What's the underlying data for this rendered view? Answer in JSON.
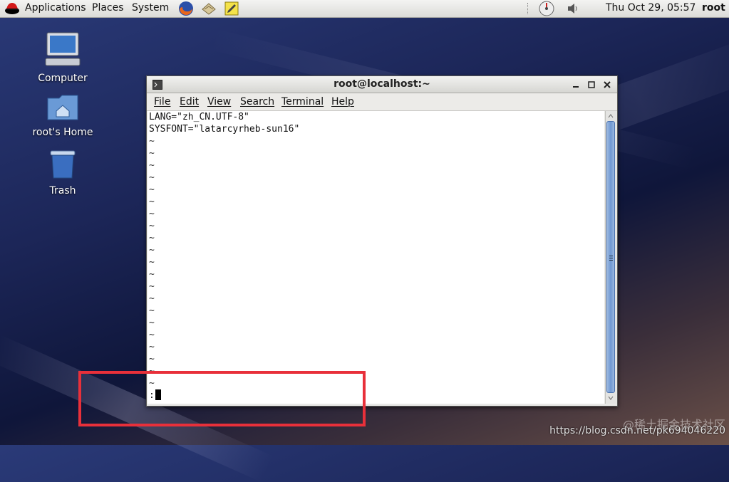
{
  "top_panel": {
    "applications": "Applications",
    "places": "Places",
    "system": "System",
    "clock": "Thu Oct 29, 05:57",
    "user": "root",
    "launchers": [
      "firefox-icon",
      "mail-icon",
      "notes-icon"
    ]
  },
  "desktop": {
    "icons": [
      {
        "label": "Computer",
        "icon": "computer-icon"
      },
      {
        "label": "root's Home",
        "icon": "home-folder-icon"
      },
      {
        "label": "Trash",
        "icon": "trash-icon"
      }
    ]
  },
  "window": {
    "title": "root@localhost:~",
    "menu": [
      "File",
      "Edit",
      "View",
      "Search",
      "Terminal",
      "Help"
    ],
    "lines": {
      "line1": "LANG=\"zh_CN.UTF-8\"",
      "line2": "SYSFONT=\"latarcyrheb-sun16\"",
      "tilde": "~",
      "prompt": ":"
    }
  },
  "annotation": {
    "box_color": "#e8303a"
  },
  "watermark": {
    "url": "https://blog.csdn.net/pk694046220",
    "site": "@稀土掘金技术社区"
  },
  "colors": {
    "scroll_thumb": "#6f98d2"
  }
}
